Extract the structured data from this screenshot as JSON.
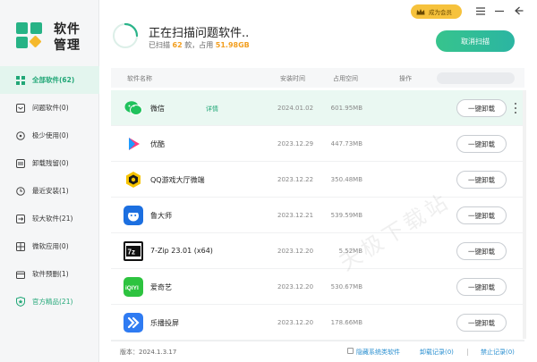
{
  "app": {
    "title": "软件\n管理",
    "title_line1": "软件",
    "title_line2": "管理"
  },
  "header": {
    "scan_title": "正在扫描问题软件..",
    "scan_sub_prefix": "已扫描",
    "scanned_count": "62",
    "scan_sub_mid": "款，占用",
    "scanned_size": "51.98GB",
    "cancel_label": "取消扫描",
    "vip_label": "成为会员"
  },
  "sidebar": {
    "items": [
      {
        "label": "全部软件(62)",
        "icon": "grid-icon",
        "active": true
      },
      {
        "label": "问题软件(0)",
        "icon": "warning-box-icon"
      },
      {
        "label": "极少使用(0)",
        "icon": "clock-gauge-icon"
      },
      {
        "label": "卸载残留(0)",
        "icon": "trash-icon"
      },
      {
        "label": "最近安装(1)",
        "icon": "clock-icon"
      },
      {
        "label": "较大软件(21)",
        "icon": "expand-icon"
      },
      {
        "label": "微软应用(0)",
        "icon": "windows-icon"
      },
      {
        "label": "软件预删(1)",
        "icon": "box-icon"
      },
      {
        "label": "官方精品(21)",
        "icon": "shield-star-icon",
        "green": true
      }
    ]
  },
  "table": {
    "columns": {
      "name": "软件名称",
      "date": "安装时间",
      "size": "占用空间",
      "action": "操作"
    },
    "detail_label": "详情",
    "uninstall_label": "一键卸载",
    "rows": [
      {
        "name": "微信",
        "date": "2024.01.02",
        "size": "601.95MB",
        "icon": "wechat-icon",
        "color": "#1fc25c"
      },
      {
        "name": "优酷",
        "date": "2023.12.29",
        "size": "447.73MB",
        "icon": "youku-icon",
        "color": "#1e9bff"
      },
      {
        "name": "QQ游戏大厅微端",
        "date": "2023.12.22",
        "size": "350.48MB",
        "icon": "qqgame-icon",
        "color": "#f6c300"
      },
      {
        "name": "鲁大师",
        "date": "2023.12.21",
        "size": "539.59MB",
        "icon": "ludashi-icon",
        "color": "#1c6fe0"
      },
      {
        "name": "7-Zip 23.01 (x64)",
        "date": "2023.12.20",
        "size": "5.52MB",
        "icon": "7zip-icon",
        "color": "#111111"
      },
      {
        "name": "爱奇艺",
        "date": "2023.12.20",
        "size": "530.67MB",
        "icon": "iqiyi-icon",
        "color": "#2dc33f"
      },
      {
        "name": "乐播投屏",
        "date": "2023.12.20",
        "size": "178.66MB",
        "icon": "lebo-icon",
        "color": "#2f7bf2"
      }
    ]
  },
  "footer": {
    "version": "版本：2024.1.3.17",
    "hide_system": "隐藏系统类软件",
    "uninstall_record": "卸载记录(0)",
    "block_record": "禁止记录(0)"
  },
  "watermark": "天极下载站",
  "colors": {
    "accent": "#21a777",
    "highlight": "#f29e1f",
    "vip": "#f6c23c"
  }
}
